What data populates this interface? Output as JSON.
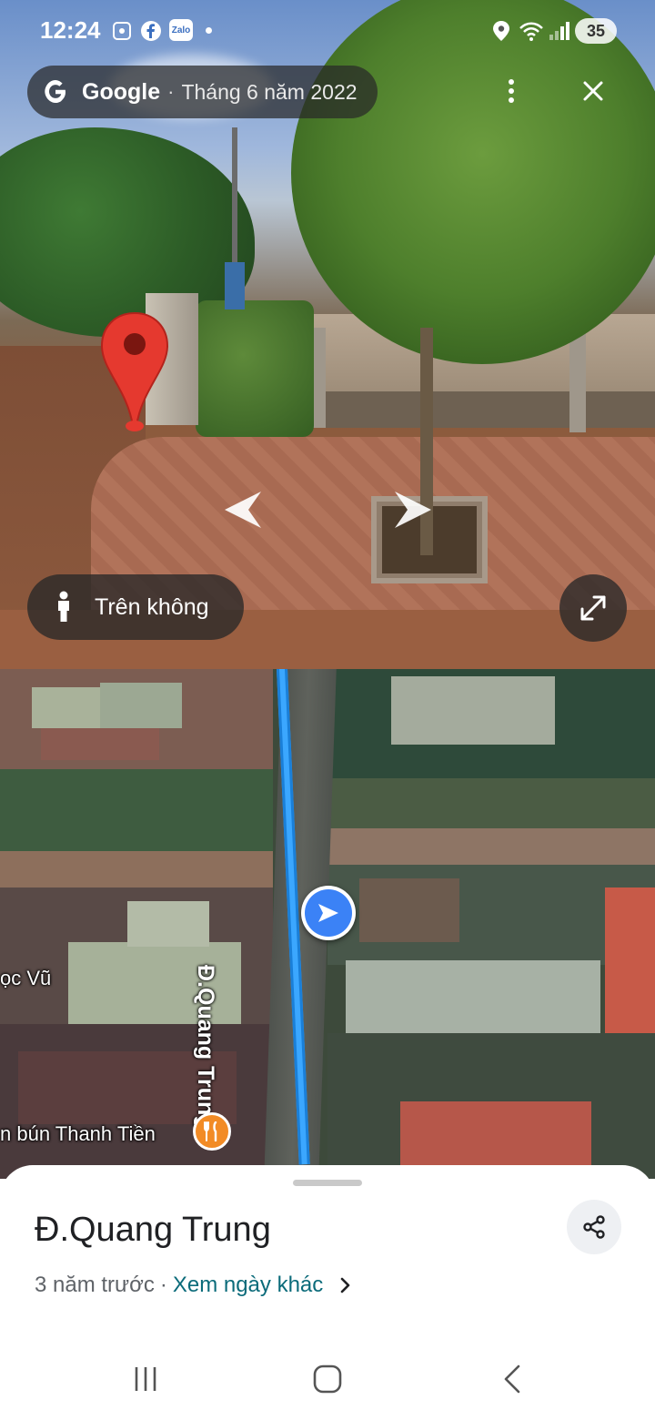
{
  "status_bar": {
    "time": "12:24",
    "icons": [
      "screenshot-icon",
      "facebook-icon",
      "zalo-icon",
      "dot-icon",
      "location-icon",
      "wifi-icon",
      "signal-icon"
    ],
    "zalo_label": "Zalo",
    "battery": "35"
  },
  "street_view": {
    "provider": "Google",
    "separator": "·",
    "date": "Tháng 6 năm 2022",
    "aerial_label": "Trên không"
  },
  "map": {
    "street_name": "Đ.Quang Trung",
    "labels": [
      "ọc Vũ",
      "n bún Thanh Tiền"
    ],
    "route_color": "#3ba7ff",
    "poi_color": "#f28b25"
  },
  "sheet": {
    "title": "Đ.Quang Trung",
    "age": "3 năm trước",
    "separator": "·",
    "link": "Xem ngày khác"
  },
  "colors": {
    "accent_link": "#0b6b7a",
    "overlay": "rgba(40,40,40,0.72)"
  }
}
